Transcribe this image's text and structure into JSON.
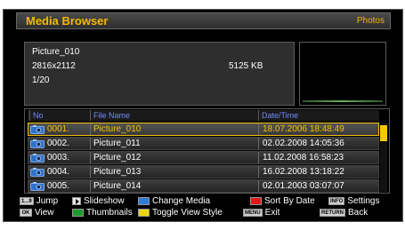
{
  "header": {
    "title": "Media Browser",
    "section": "Photos"
  },
  "info": {
    "filename": "Picture_010",
    "resolution": "2816x2112",
    "filesize": "5125 KB",
    "position": "1/20"
  },
  "table": {
    "columns": [
      "No",
      "File Name",
      "Date/Time"
    ],
    "rows": [
      {
        "no": "0001.",
        "name": "Picture_010",
        "date": "18.07.2006 18:48:49",
        "selected": true
      },
      {
        "no": "0002.",
        "name": "Picture_011",
        "date": "02.02.2008 14:05:36",
        "selected": false
      },
      {
        "no": "0003.",
        "name": "Picture_012",
        "date": "11.02.2008 16:58:23",
        "selected": false
      },
      {
        "no": "0004.",
        "name": "Picture_013",
        "date": "16.02.2008 13:18:22",
        "selected": false
      },
      {
        "no": "0005.",
        "name": "Picture_014",
        "date": "02.01.2003 03:07:07",
        "selected": false
      }
    ],
    "scroll_position": 0.05
  },
  "help": {
    "jump_key": "1...9",
    "jump": "Jump",
    "slideshow": "Slideshow",
    "change_media": "Change Media",
    "sort_by_date": "Sort By Date",
    "info_key": "INFO",
    "settings": "Settings",
    "ok_key": "OK",
    "view": "View",
    "thumbnails": "Thumbnails",
    "toggle_view": "Toggle View Style",
    "menu_key": "MENU",
    "exit": "Exit",
    "return_key": "RETURN",
    "back": "Back"
  },
  "colors": {
    "accent": "#f5b800",
    "header_text": "#6f8cff",
    "blue_key": "#2f7bd8",
    "green_key": "#1f9a2f",
    "yellow_key": "#e8d800",
    "red_key": "#e01818"
  }
}
